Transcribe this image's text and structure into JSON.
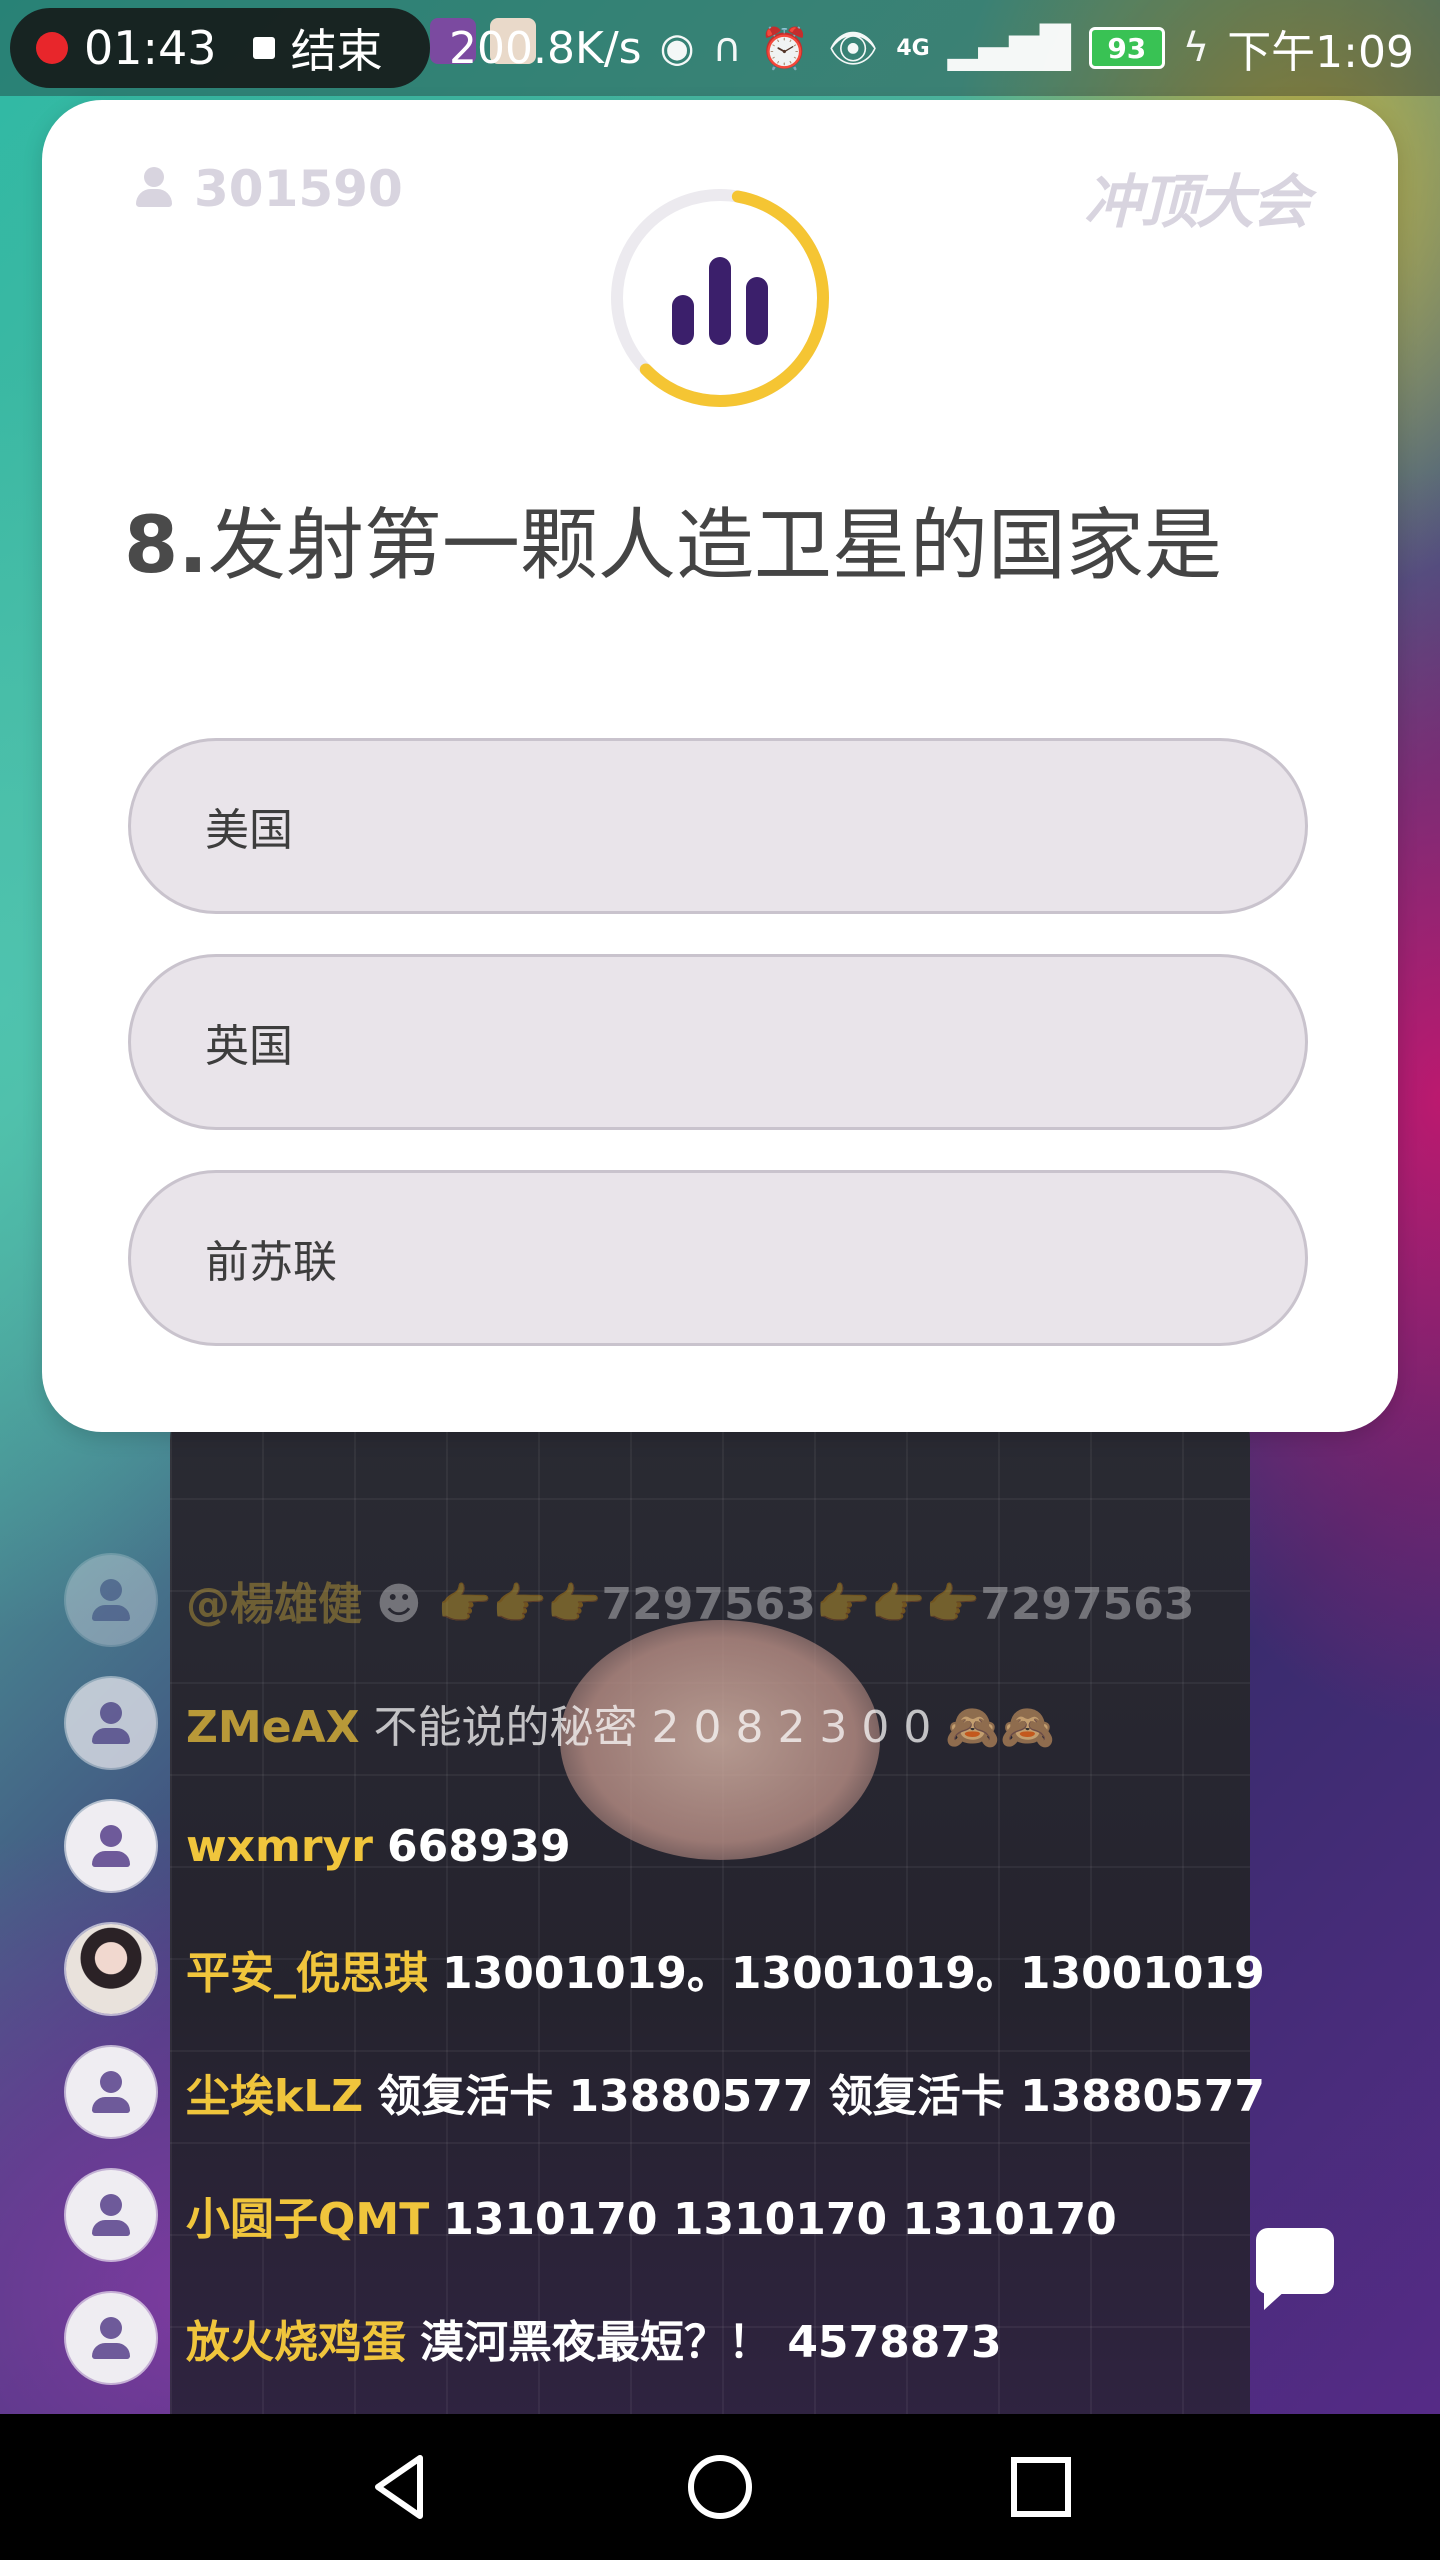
{
  "status_bar": {
    "recording_time": "01:43",
    "stop_label": "结束",
    "network_speed": "200.8K/s",
    "signal_label": "4G",
    "battery": "93",
    "time": "下午1:09"
  },
  "quiz": {
    "viewer_count": "301590",
    "brand": "冲顶大会",
    "timer_progress": 0.6,
    "question_number": "8.",
    "question_text": "发射第一颗人造卫星的国家是",
    "options": [
      "美国",
      "英国",
      "前苏联"
    ]
  },
  "chat": [
    {
      "name": "@楊雄健",
      "message": "☻ 👉👉👉7297563👉👉👉7297563"
    },
    {
      "name": "ZMeAX",
      "message": "不能说的秘密 2 0 8 2 3 0 0 🙈🙈"
    },
    {
      "name": "wxmryr",
      "message": "668939"
    },
    {
      "name": "平安_倪思琪",
      "message": "13001019。13001019。13001019"
    },
    {
      "name": "尘埃kLZ",
      "message": "领复活卡  13880577  领复活卡  13880577"
    },
    {
      "name": "小圆子QMT",
      "message": "1310170   1310170  1310170"
    },
    {
      "name": "放火烧鸡蛋",
      "message": "漠河黑夜最短？！ 4578873"
    }
  ],
  "colors": {
    "accent_ring": "#f5c533",
    "chat_name": "#f0c53c",
    "icon_purple": "#3b1f6b"
  }
}
